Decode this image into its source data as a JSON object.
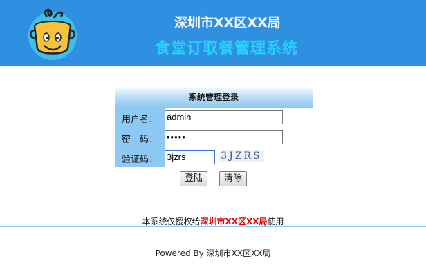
{
  "header": {
    "org_title": "深圳市XX区XX局",
    "system_title": "食堂订取餐管理系统",
    "logo_icon": "cooking-pot-mascot-icon"
  },
  "login": {
    "panel_title": "系统管理登录",
    "username_label": "用户名：",
    "username_value": "admin",
    "password_label": "密　码：",
    "password_value": "•••••",
    "captcha_label": "验证码：",
    "captcha_input_value": "3jzrs",
    "captcha_image_text": "3JZRS",
    "login_button": "登陆",
    "clear_button": "清除"
  },
  "license": {
    "prefix": "本系统仅授权给",
    "org": "深圳市XX区XX局",
    "suffix": "使用"
  },
  "footer": {
    "powered_by": "Powered By 深圳市XX区XX局"
  },
  "colors": {
    "header_bg": "#2f8fe0",
    "system_title": "#28d0ff",
    "label_column_bg": "#8ec9f4",
    "license_highlight": "#e00000"
  }
}
